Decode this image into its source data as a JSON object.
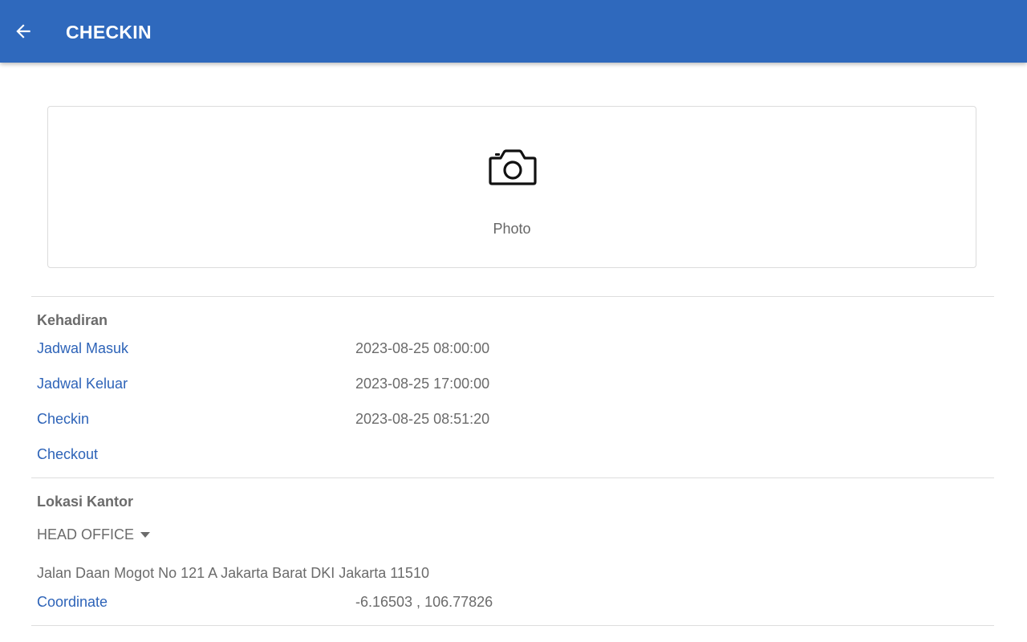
{
  "appbar": {
    "title": "CHECKIN",
    "back_icon": "arrow-left-icon",
    "color": "#2f69bd"
  },
  "photo": {
    "label": "Photo",
    "icon": "camera-icon"
  },
  "attendance": {
    "title": "Kehadiran",
    "rows": [
      {
        "label": "Jadwal Masuk",
        "value": "2023-08-25 08:00:00"
      },
      {
        "label": "Jadwal Keluar",
        "value": "2023-08-25 17:00:00"
      },
      {
        "label": "Checkin",
        "value": "2023-08-25 08:51:20"
      },
      {
        "label": "Checkout",
        "value": ""
      }
    ]
  },
  "office": {
    "title": "Lokasi Kantor",
    "selected": "HEAD OFFICE",
    "address": "Jalan Daan Mogot No 121 A Jakarta Barat DKI Jakarta 11510",
    "coordinate_label": "Coordinate",
    "coordinate_value": "-6.16503 , 106.77826"
  },
  "colors": {
    "link": "#2d63b8",
    "text_muted": "#6b6b6b"
  }
}
